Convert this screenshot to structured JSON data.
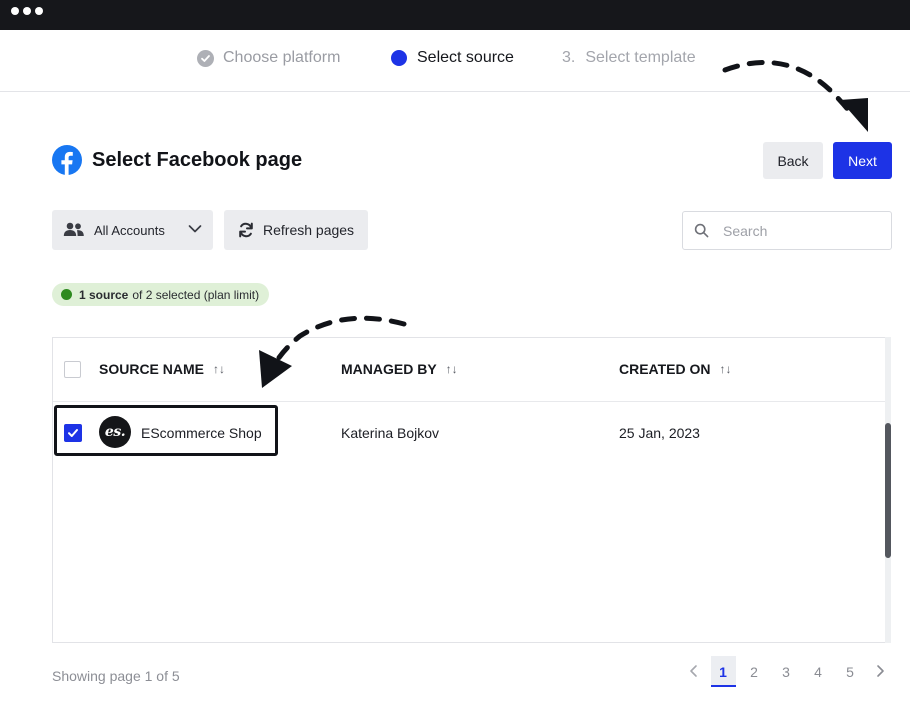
{
  "window": {
    "dots": 3
  },
  "stepper": {
    "steps": [
      {
        "label": "Choose platform",
        "state": "done"
      },
      {
        "label": "Select source",
        "state": "active"
      },
      {
        "number": "3.",
        "label": "Select template",
        "state": "upcoming"
      }
    ]
  },
  "header": {
    "title": "Select Facebook page",
    "back_label": "Back",
    "next_label": "Next"
  },
  "toolbar": {
    "account_filter": "All Accounts",
    "refresh_label": "Refresh pages",
    "search_placeholder": "Search"
  },
  "limit_badge": {
    "bold": "1 source",
    "rest": "of 2 selected (plan limit)"
  },
  "table": {
    "columns": [
      "SOURCE NAME",
      "MANAGED BY",
      "CREATED ON"
    ],
    "sort_glyph": "↑↓",
    "rows": [
      {
        "avatar_text": "es.",
        "name": "EScommerce Shop",
        "managed_by": "Katerina Bojkov",
        "created_on": "25 Jan, 2023",
        "selected": true
      }
    ]
  },
  "pagination": {
    "summary": "Showing page 1 of 5",
    "pages": [
      "1",
      "2",
      "3",
      "4",
      "5"
    ],
    "current": "1"
  },
  "colors": {
    "accent": "#1d33e6",
    "badge_bg": "#dff0d7",
    "badge_dot": "#2e8a1f",
    "facebook_blue": "#1877f2"
  },
  "icons": [
    "check-icon",
    "facebook-icon",
    "users-icon",
    "chevron-down-icon",
    "refresh-icon",
    "search-icon",
    "sort-icon",
    "chevron-left-icon",
    "chevron-right-icon",
    "annotation-arrow"
  ]
}
